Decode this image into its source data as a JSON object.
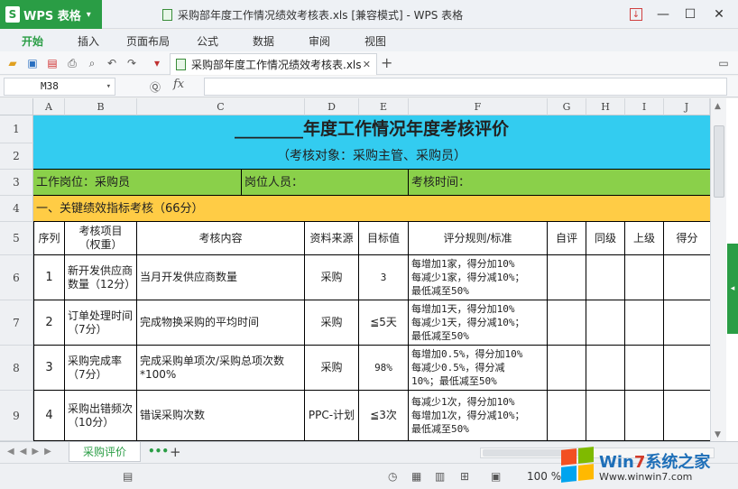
{
  "app": {
    "name": "WPS 表格",
    "window_title": "采购部年度工作情况绩效考核表.xls [兼容模式] - WPS 表格"
  },
  "menu": {
    "tabs": [
      "开始",
      "插入",
      "页面布局",
      "公式",
      "数据",
      "审阅",
      "视图"
    ],
    "active": "开始"
  },
  "toolbar": {
    "doc_tab": "采购部年度工作情况绩效考核表.xls"
  },
  "formula_bar": {
    "cell_ref": "M38",
    "fx": "fx",
    "content": ""
  },
  "columns": [
    "A",
    "B",
    "C",
    "D",
    "E",
    "F",
    "G",
    "H",
    "I",
    "J"
  ],
  "rows": [
    "1",
    "2",
    "3",
    "4",
    "5",
    "6",
    "7",
    "8",
    "9"
  ],
  "sheet": {
    "title": "________年度工作情况年度考核评价",
    "subtitle": "（考核对象：采购主管、采购员）",
    "row3": {
      "position": "工作岗位：采购员",
      "person": "岗位人员：",
      "time": "考核时间："
    },
    "section": "一、关键绩效指标考核（66分）",
    "headers": {
      "seq": "序列",
      "item": "考核项目（权重）",
      "content": "考核内容",
      "source": "资料来源",
      "target": "目标值",
      "rule": "评分规则/标准",
      "self": "自评",
      "peer": "同级",
      "superior": "上级",
      "score": "得分"
    },
    "items": [
      {
        "seq": "1",
        "item": "新开发供应商数量（12分）",
        "content": "当月开发供应商数量",
        "source": "采购",
        "target": "3",
        "rule": [
          "每增加1家，得分加10%",
          "每减少1家，得分减10%；",
          "最低减至50%"
        ]
      },
      {
        "seq": "2",
        "item": "订单处理时间（7分）",
        "content": "完成物换采购的平均时间",
        "source": "采购",
        "target": "≦5天",
        "rule": [
          "每增加1天，得分加10%",
          "每减少1天，得分减10%；",
          "最低减至50%"
        ]
      },
      {
        "seq": "3",
        "item": "采购完成率（7分）",
        "content": "完成采购单项次/采购总项次数*100%",
        "source": "采购",
        "target": "98%",
        "rule": [
          "每增加0.5%，得分加10%",
          "每减少0.5%，得分减",
          "10%；最低减至50%"
        ]
      },
      {
        "seq": "4",
        "item": "采购出错频次（10分）",
        "content": "错误采购次数",
        "source": "PPC-计划",
        "target": "≦3次",
        "rule": [
          "每减少1次，得分加10%",
          "每增加1次，得分减10%；",
          "最低减至50%"
        ]
      }
    ]
  },
  "sheet_tabs": {
    "active": "采购评价",
    "more": "•••",
    "add": "+"
  },
  "status": {
    "zoom": "100 %"
  },
  "watermark": {
    "brand_a": "Win",
    "brand_b": "7",
    "brand_c": "系统之家",
    "url": "Www.winwin7.com"
  },
  "colors": {
    "accent": "#2a9d45",
    "title_fill": "#33ccf0",
    "info_fill": "#8ad04a",
    "section_fill": "#ffcc45"
  }
}
